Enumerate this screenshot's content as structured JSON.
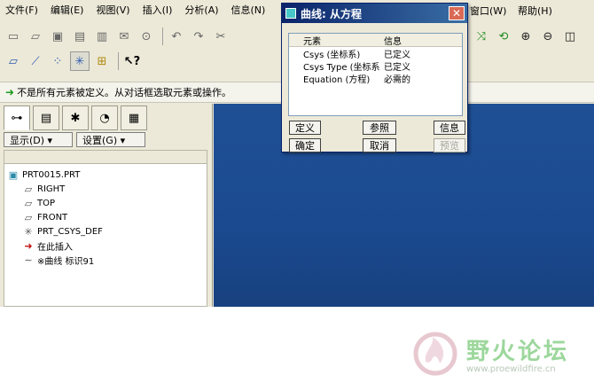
{
  "menubar": {
    "items": [
      "文件(F)",
      "编辑(E)",
      "视图(V)",
      "插入(I)",
      "分析(A)",
      "信息(N)"
    ],
    "window": "窗口(W)",
    "help": "帮助(H)"
  },
  "message": "不是所有元素被定义。从对话框选取元素或操作。",
  "panel": {
    "show_label": "显示(D) ▾",
    "settings_label": "设置(G) ▾"
  },
  "tree": {
    "root": "PRT0015.PRT",
    "items": [
      "RIGHT",
      "TOP",
      "FRONT",
      "PRT_CSYS_DEF",
      "在此插入",
      "※曲线 标识91"
    ]
  },
  "dialog": {
    "title": "曲线: 从方程",
    "col_element": "元素",
    "col_info": "信息",
    "rows": [
      {
        "element": "Csys (坐标系)",
        "info": "已定义"
      },
      {
        "element": "Csys Type (坐标系",
        "info": "已定义"
      },
      {
        "element": "Equation (方程)",
        "info": "必需的"
      }
    ],
    "btn_define": "定义",
    "btn_reference": "参照",
    "btn_info": "信息",
    "btn_ok": "确定",
    "btn_cancel": "取消",
    "btn_preview": "预览"
  },
  "watermark": {
    "name": "野火论坛",
    "url": "www.proewildfire.cn"
  },
  "colors": {
    "graphics_bg": "#1f4f94",
    "title_bar": "#0a246a",
    "accent_green": "#1a9a1a"
  }
}
